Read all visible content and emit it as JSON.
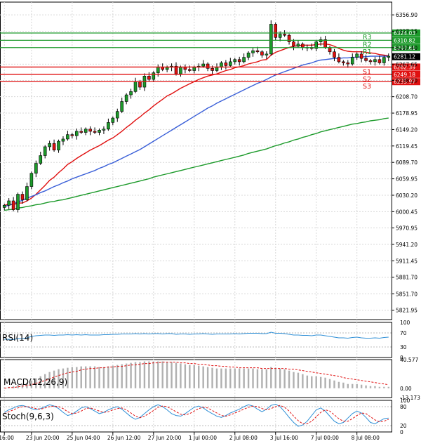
{
  "chart_data": [
    {
      "type": "line",
      "subtype": "candlestick",
      "title": "",
      "xlabel": "",
      "ylabel": "",
      "ylim": [
        5805,
        6380
      ],
      "y_ticks": [
        "6356.90",
        "6327.15",
        "6297.40",
        "6267.65",
        "6238.20",
        "6208.70",
        "6178.95",
        "6149.20",
        "6119.45",
        "6089.70",
        "6059.95",
        "6030.20",
        "6000.45",
        "5970.95",
        "5941.20",
        "5911.45",
        "5881.70",
        "5851.70",
        "5821.95"
      ],
      "x_ticks": [
        "16:00",
        "23 Jun 20:00",
        "25 Jun 04:00",
        "26 Jun 12:00",
        "27 Jun 20:00",
        "1 Jul 00:00",
        "2 Jul 08:00",
        "3 Jul 16:00",
        "7 Jul 00:00",
        "8 Jul 08:00"
      ],
      "x_tick_bar_index": [
        0,
        6,
        15,
        24,
        33,
        42,
        51,
        60,
        69,
        78
      ],
      "candles_close": [
        6012,
        6020,
        6004,
        6032,
        6022,
        6046,
        6070,
        6088,
        6102,
        6118,
        6124,
        6112,
        6128,
        6132,
        6140,
        6138,
        6146,
        6144,
        6150,
        6146,
        6144,
        6148,
        6150,
        6162,
        6170,
        6182,
        6200,
        6212,
        6218,
        6236,
        6226,
        6246,
        6240,
        6252,
        6262,
        6258,
        6262,
        6264,
        6250,
        6262,
        6258,
        6256,
        6262,
        6264,
        6268,
        6260,
        6256,
        6262,
        6270,
        6265,
        6272,
        6276,
        6272,
        6280,
        6288,
        6292,
        6290,
        6284,
        6286,
        6340,
        6316,
        6322,
        6320,
        6308,
        6300,
        6304,
        6298,
        6298,
        6296,
        6308,
        6312,
        6298,
        6290,
        6280,
        6272,
        6270,
        6268,
        6280,
        6286,
        6278,
        6274,
        6272,
        6276,
        6270,
        6280,
        6282
      ],
      "series": [
        {
          "name": "",
          "color": "#e01010",
          "values": [
            6012,
            6014,
            6013,
            6016,
            6016,
            6020,
            6025,
            6032,
            6040,
            6048,
            6057,
            6063,
            6071,
            6078,
            6086,
            6091,
            6097,
            6102,
            6107,
            6112,
            6116,
            6120,
            6125,
            6130,
            6134,
            6140,
            6146,
            6153,
            6159,
            6166,
            6172,
            6179,
            6185,
            6192,
            6198,
            6204,
            6210,
            6214,
            6219,
            6224,
            6228,
            6232,
            6236,
            6240,
            6243,
            6246,
            6248,
            6250,
            6253,
            6256,
            6258,
            6261,
            6263,
            6265,
            6268,
            6270,
            6272,
            6275,
            6276,
            6284,
            6289,
            6292,
            6295,
            6298,
            6300,
            6301,
            6302,
            6302,
            6302,
            6303,
            6304,
            6304,
            6303,
            6300,
            6296,
            6293,
            6291,
            6290,
            6290,
            6290,
            6289,
            6288,
            6287,
            6285,
            6284,
            6283
          ]
        },
        {
          "name": "",
          "color": "#3a5fd8",
          "values": [
            6010,
            6012,
            6015,
            6018,
            6021,
            6025,
            6028,
            6031,
            6035,
            6038,
            6042,
            6046,
            6049,
            6053,
            6056,
            6060,
            6063,
            6066,
            6069,
            6072,
            6075,
            6079,
            6082,
            6086,
            6089,
            6093,
            6097,
            6101,
            6105,
            6109,
            6113,
            6118,
            6123,
            6128,
            6133,
            6138,
            6143,
            6148,
            6153,
            6158,
            6163,
            6168,
            6173,
            6178,
            6183,
            6188,
            6192,
            6197,
            6201,
            6205,
            6209,
            6213,
            6217,
            6221,
            6225,
            6229,
            6233,
            6236,
            6240,
            6244,
            6248,
            6251,
            6254,
            6257,
            6260,
            6263,
            6266,
            6268,
            6270,
            6273,
            6275,
            6276,
            6277,
            6278,
            6278,
            6279,
            6279,
            6280,
            6280,
            6281,
            6281,
            6282,
            6282,
            6282,
            6282,
            6282
          ]
        },
        {
          "name": "",
          "color": "#1c9a2a",
          "values": [
            6003,
            6004,
            6005,
            6007,
            6008,
            6010,
            6011,
            6013,
            6014,
            6016,
            6018,
            6019,
            6021,
            6022,
            6024,
            6026,
            6028,
            6030,
            6032,
            6034,
            6036,
            6038,
            6040,
            6042,
            6044,
            6046,
            6048,
            6050,
            6052,
            6054,
            6056,
            6058,
            6060,
            6063,
            6065,
            6067,
            6069,
            6071,
            6073,
            6075,
            6077,
            6079,
            6081,
            6083,
            6085,
            6087,
            6089,
            6091,
            6093,
            6095,
            6097,
            6099,
            6101,
            6103,
            6106,
            6108,
            6110,
            6112,
            6114,
            6117,
            6120,
            6122,
            6125,
            6127,
            6130,
            6132,
            6135,
            6137,
            6140,
            6142,
            6145,
            6147,
            6149,
            6151,
            6153,
            6155,
            6157,
            6159,
            6160,
            6162,
            6163,
            6165,
            6166,
            6167,
            6169,
            6170
          ]
        }
      ],
      "current_price": "6281.12",
      "levels": [
        {
          "label": "R3",
          "value": 6324.03,
          "value_label": "6324.03",
          "color": "#1c9a2a"
        },
        {
          "label": "R2",
          "value": 6310.82,
          "value_label": "6310.82",
          "color": "#1c9a2a"
        },
        {
          "label": "R1",
          "value": 6297.61,
          "value_label": "6297.61",
          "color": "#1c9a2a"
        },
        {
          "label": "S1",
          "value": 6262.39,
          "value_label": "6262.39",
          "color": "#e01010"
        },
        {
          "label": "S2",
          "value": 6249.18,
          "value_label": "6249.18",
          "color": "#e01010"
        },
        {
          "label": "S3",
          "value": 6235.97,
          "value_label": "6235.97",
          "color": "#e01010"
        }
      ],
      "up_color": "#1c9a2a",
      "down_color": "#e01010",
      "grid": true
    },
    {
      "type": "line",
      "title": "RSI(14)",
      "ylim": [
        0,
        100
      ],
      "y_ticks": [
        "100",
        "70",
        "30",
        "0"
      ],
      "series": [
        {
          "name": "",
          "color": "#2f8fd6",
          "values": [
            52,
            52,
            51,
            54,
            53,
            56,
            60,
            62,
            63,
            64,
            64,
            63,
            64,
            64,
            65,
            64,
            65,
            64,
            65,
            64,
            64,
            64,
            65,
            65,
            66,
            66,
            67,
            67,
            67,
            68,
            67,
            68,
            67,
            68,
            68,
            67,
            68,
            68,
            66,
            67,
            67,
            66,
            67,
            67,
            68,
            67,
            66,
            67,
            67,
            67,
            67,
            68,
            67,
            68,
            69,
            69,
            69,
            68,
            68,
            72,
            69,
            69,
            68,
            66,
            64,
            64,
            63,
            63,
            62,
            64,
            64,
            62,
            60,
            58,
            56,
            56,
            55,
            57,
            58,
            56,
            55,
            55,
            56,
            55,
            57,
            58
          ]
        }
      ]
    },
    {
      "type": "bar",
      "title": "MACD(12,26,9)",
      "ylim": [
        -13.173,
        40.577
      ],
      "y_ticks": [
        "40.577",
        "0.00",
        "-13.173"
      ],
      "values": [
        1,
        2,
        3,
        5,
        6,
        8,
        11,
        14,
        17,
        20,
        23,
        25,
        27,
        28,
        29,
        30,
        30,
        31,
        31,
        31,
        31,
        30,
        30,
        31,
        32,
        33,
        34,
        35,
        36,
        37,
        37,
        38,
        38,
        38,
        38,
        38,
        37,
        37,
        36,
        35,
        34,
        33,
        33,
        32,
        31,
        30,
        29,
        28,
        28,
        28,
        28,
        28,
        28,
        28,
        28,
        28,
        27,
        27,
        27,
        30,
        29,
        28,
        27,
        25,
        23,
        22,
        20,
        18,
        17,
        17,
        16,
        15,
        13,
        11,
        9,
        8,
        6,
        6,
        6,
        5,
        4,
        3,
        3,
        2,
        2,
        2
      ],
      "series": [
        {
          "name": "",
          "color": "#e01010",
          "values": [
            0,
            1,
            1,
            2,
            3,
            4,
            5,
            7,
            9,
            11,
            13,
            16,
            18,
            20,
            22,
            23,
            24,
            26,
            27,
            28,
            28,
            29,
            29,
            30,
            30,
            31,
            31,
            32,
            33,
            33,
            34,
            35,
            35,
            36,
            36,
            37,
            37,
            37,
            37,
            36,
            36,
            35,
            35,
            34,
            34,
            33,
            32,
            32,
            31,
            31,
            30,
            30,
            29,
            29,
            29,
            29,
            29,
            28,
            28,
            28,
            28,
            28,
            28,
            27,
            27,
            26,
            25,
            24,
            23,
            22,
            21,
            20,
            19,
            18,
            17,
            15,
            14,
            13,
            12,
            11,
            10,
            9,
            8,
            7,
            6,
            5
          ]
        }
      ]
    },
    {
      "type": "line",
      "title": "Stoch(9,6,3)",
      "ylim": [
        0,
        100
      ],
      "y_ticks": [
        "100",
        "80",
        "20",
        "0"
      ],
      "series": [
        {
          "name": "",
          "color": "#2f8fd6",
          "values": [
            62,
            70,
            76,
            82,
            84,
            80,
            74,
            70,
            74,
            80,
            86,
            82,
            74,
            62,
            52,
            56,
            66,
            76,
            80,
            74,
            66,
            58,
            62,
            70,
            76,
            80,
            72,
            60,
            48,
            40,
            46,
            58,
            70,
            80,
            86,
            80,
            70,
            58,
            52,
            50,
            58,
            68,
            78,
            82,
            76,
            66,
            58,
            50,
            46,
            52,
            60,
            66,
            72,
            80,
            86,
            82,
            72,
            64,
            72,
            84,
            88,
            80,
            64,
            46,
            30,
            18,
            22,
            34,
            52,
            70,
            76,
            66,
            50,
            34,
            26,
            30,
            44,
            58,
            66,
            60,
            46,
            30,
            26,
            34,
            42,
            44
          ]
        },
        {
          "name": "",
          "color": "#e01010",
          "values": [
            58,
            64,
            70,
            76,
            80,
            80,
            78,
            74,
            72,
            76,
            80,
            82,
            80,
            74,
            64,
            58,
            60,
            66,
            74,
            76,
            72,
            66,
            62,
            64,
            70,
            74,
            76,
            70,
            60,
            50,
            45,
            50,
            58,
            68,
            78,
            82,
            80,
            72,
            64,
            56,
            54,
            58,
            66,
            74,
            78,
            76,
            68,
            60,
            52,
            50,
            54,
            60,
            66,
            72,
            78,
            82,
            80,
            74,
            70,
            74,
            80,
            84,
            78,
            66,
            50,
            36,
            26,
            26,
            34,
            48,
            62,
            70,
            66,
            54,
            42,
            34,
            34,
            42,
            52,
            60,
            58,
            48,
            38,
            32,
            34,
            40
          ]
        }
      ]
    }
  ]
}
